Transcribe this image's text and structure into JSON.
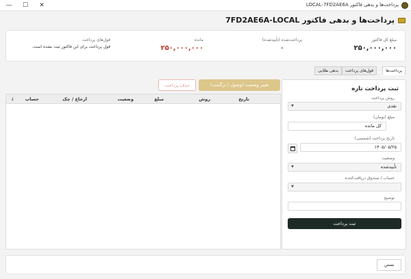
{
  "window": {
    "title": "پرداخت‌ها و بدهی فاکتور LOCAL-7FD2AE6A",
    "minimize": "—",
    "maximize": "☐",
    "close": "✕"
  },
  "header": {
    "title": "پرداخت‌ها و بدهی فاکتور 7FD2AE6A-LOCAL"
  },
  "summary": {
    "total_label": "مبلغ کل فاکتور",
    "total_value": "۲۵۰,۰۰۰,۰۰۰",
    "confirmed_label": "پرداخت‌شده (تأییدشده)",
    "confirmed_value": "۰",
    "remaining_label": "مانده",
    "remaining_value": "۲۵۰,۰۰۰,۰۰۰",
    "remaining_color": "#c0392b",
    "installments_label": "قول‌های پرداخت",
    "installments_note": "قول پرداخت برای این فاکتور ثبت نشده است."
  },
  "tabs": [
    {
      "label": "پرداخت‌ها",
      "active": true
    },
    {
      "label": "قول‌های پرداخت",
      "active": false
    },
    {
      "label": "بدهی طلایی",
      "active": false
    }
  ],
  "actions": {
    "change_status_label": "تغییر وضعیت (وصول / برگشت)",
    "delete_label": "حذف پرداخت"
  },
  "table": {
    "columns": [
      "تاریخ",
      "روش",
      "مبلغ",
      "وضعیت",
      "ارجاع / چک",
      "حساب"
    ],
    "sort_indicator": "↓",
    "rows": []
  },
  "form": {
    "title": "ثبت پرداخت تازه",
    "method_label": "روش پرداخت",
    "method_value": "نقدی",
    "amount_label": "مبلغ (تومان)",
    "amount_value": "کل مانده",
    "date_label": "تاریخ پرداخت (شمسی)",
    "date_value": "۱۴۰۵/۰۵/۲۵",
    "status_label": "وضعیت",
    "status_value": "تأییدشده",
    "account_label": "حساب / صندوق دریافت‌کننده",
    "account_value": "",
    "description_label": "توضیح",
    "description_value": "",
    "submit_label": "ثبت پرداخت"
  },
  "footer": {
    "close_label": "بستن"
  },
  "colors": {
    "accent": "#c9a227",
    "button_dark": "#1e2a26"
  }
}
